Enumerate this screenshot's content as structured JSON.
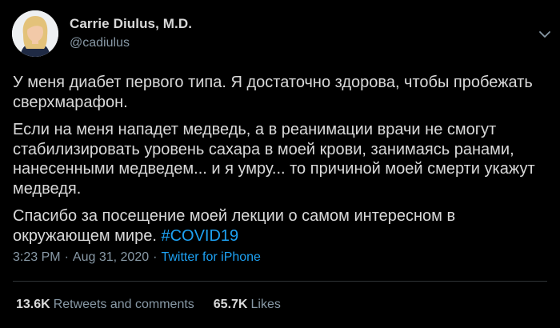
{
  "author": {
    "display_name": "Carrie Diulus, M.D.",
    "handle": "@cadiulus"
  },
  "tweet": {
    "paragraphs": [
      "У меня диабет первого типа. Я достаточно здорова, чтобы пробежать сверхмарафон.",
      "Если на меня нападет медведь, а в реанимации врачи не смогут стабилизировать уровень сахара в моей крови, занимаясь ранами, нанесенными медведем... и я умру... то причиной моей смерти укажут медведя."
    ],
    "last_paragraph_text": "Спасибо за посещение моей лекции о самом интересном в окружающем мире.",
    "hashtag": "#COVID19"
  },
  "meta": {
    "time": "3:23 PM",
    "separator": "·",
    "date": "Aug 31, 2020",
    "source": "Twitter for iPhone"
  },
  "stats": {
    "retweets_count": "13.6K",
    "retweets_label": "Retweets and comments",
    "likes_count": "65.7K",
    "likes_label": "Likes"
  },
  "icons": {
    "more": "chevron-down-icon"
  },
  "colors": {
    "background": "#000000",
    "text": "#d9d9d9",
    "muted": "#8899a6",
    "link": "#1da1f2",
    "divider": "#2f3336"
  }
}
